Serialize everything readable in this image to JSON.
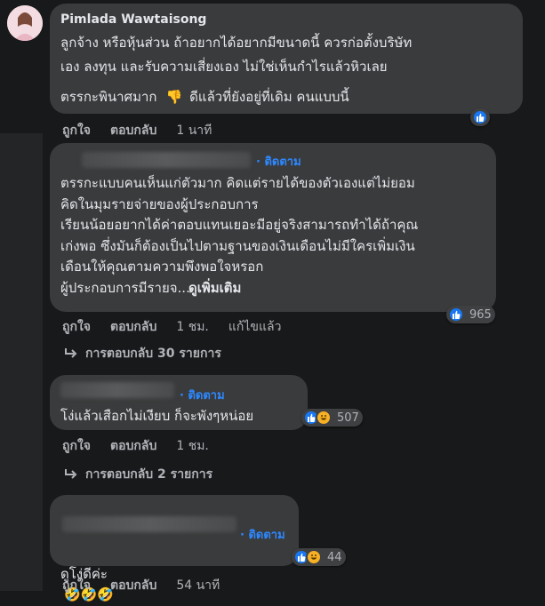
{
  "comments": [
    {
      "author": "Pimlada Wawtaisong",
      "text_lines": [
        "ลูกจ้าง หรือหุ้นส่วน ถ้าอยากได้อยากมีขนาดนี้ ควรก่อตั้งบริษัท",
        "เอง ลงทุน และรับความเสี่ยงเอง ไม่ใช่เห็นกำไรแล้วหิวเลย"
      ],
      "text_line3": "ตรรกะพินาศมาก",
      "text_line3b": "ดีแล้วที่ยังอยู่ที่เดิม คนแบบนี้",
      "like_label": "ถูกใจ",
      "reply_label": "ตอบกลับ",
      "time": "1 นาที"
    },
    {
      "follow": "ติดตาม",
      "text": "ตรรกะแบบคนเห็นแก่ตัวมาก คิดแต่รายได้ของตัวเองแต่ไม่ยอม\nคิดในมุมรายจ่ายของผู้ประกอบการ\nเรียนน้อยอยากได้ค่าตอบแทนเยอะมีอยู่จริงสามารถทำได้ถ้าคุณ\nเก่งพอ ซึ่งมันก็ต้องเป็นไปตามฐานของเงินเดือนไม่มีใครเพิ่มเงิน\nเดือนให้คุณตามความพึงพอใจหรอก\nผู้ประกอบการมีรายจ...",
      "see_more": "ดูเพิ่มเติม",
      "reactions": "965",
      "like_label": "ถูกใจ",
      "reply_label": "ตอบกลับ",
      "time": "1 ชม.",
      "edited": "แก้ไขแล้ว",
      "replies": "การตอบกลับ 30 รายการ"
    },
    {
      "follow": "ติดตาม",
      "text": "โง่แล้วเสือกไม่เงียบ ก็จะพังๆหน่อย",
      "reactions": "507",
      "like_label": "ถูกใจ",
      "reply_label": "ตอบกลับ",
      "time": "1 ชม.",
      "replies": "การตอบกลับ 2 รายการ"
    },
    {
      "follow": "ติดตาม",
      "text": "ดูโง่ดีค่ะ",
      "emoji": "🤣🤣🤣",
      "reactions": "44",
      "like_label": "ถูกใจ",
      "reply_label": "ตอบกลับ",
      "time": "54 นาที"
    }
  ],
  "colors": {
    "background": "#18191a",
    "bubble": "#3a3b3c",
    "follow": "#2d88ff",
    "like": "#1877f2",
    "haha": "#f7b125"
  }
}
